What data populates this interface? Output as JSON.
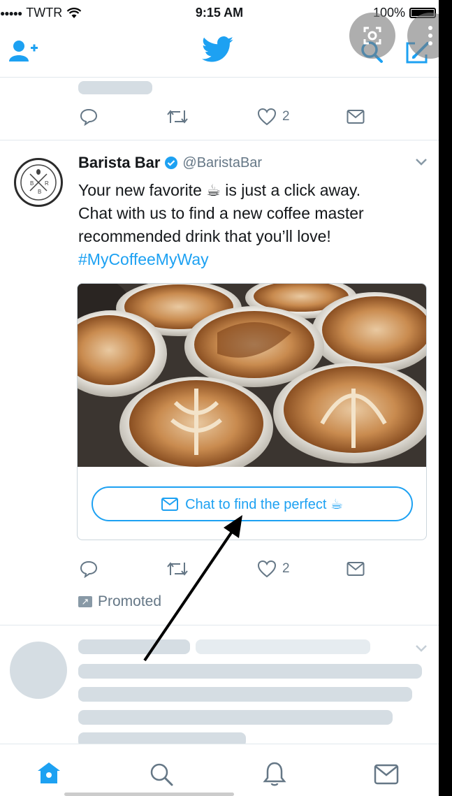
{
  "status_bar": {
    "signal_dots": "●●●●●",
    "carrier": "TWTR",
    "time": "9:15 AM",
    "battery": "100%"
  },
  "icons": {
    "add_user": "person-add-icon",
    "logo": "twitter-bird-icon",
    "search": "search-icon",
    "compose": "compose-icon",
    "lens": "lens-icon",
    "more": "more-vertical-icon"
  },
  "previous_tweet": {
    "like_count": "2"
  },
  "tweet": {
    "name": "Barista Bar",
    "handle": "@BaristaBar",
    "text_line_1": "Your new favorite ☕ is just a click away.",
    "text_line_2": "Chat with us to find a new coffee master",
    "text_line_3": "recommended drink that you’ll love!",
    "hashtag": "#MyCoffeeMyWay",
    "avatar_letters": [
      "B",
      "B",
      "R"
    ],
    "card": {
      "cta_label": "Chat to find the perfect ☕"
    },
    "like_count": "2",
    "promoted_label": "Promoted"
  },
  "tab_bar": {
    "tabs": [
      "home-icon",
      "search-icon",
      "notifications-icon",
      "messages-icon"
    ]
  },
  "colors": {
    "accent": "#1da1f2",
    "text": "#14171a",
    "secondary_text": "#657786",
    "skeleton": "#d5dde3"
  }
}
